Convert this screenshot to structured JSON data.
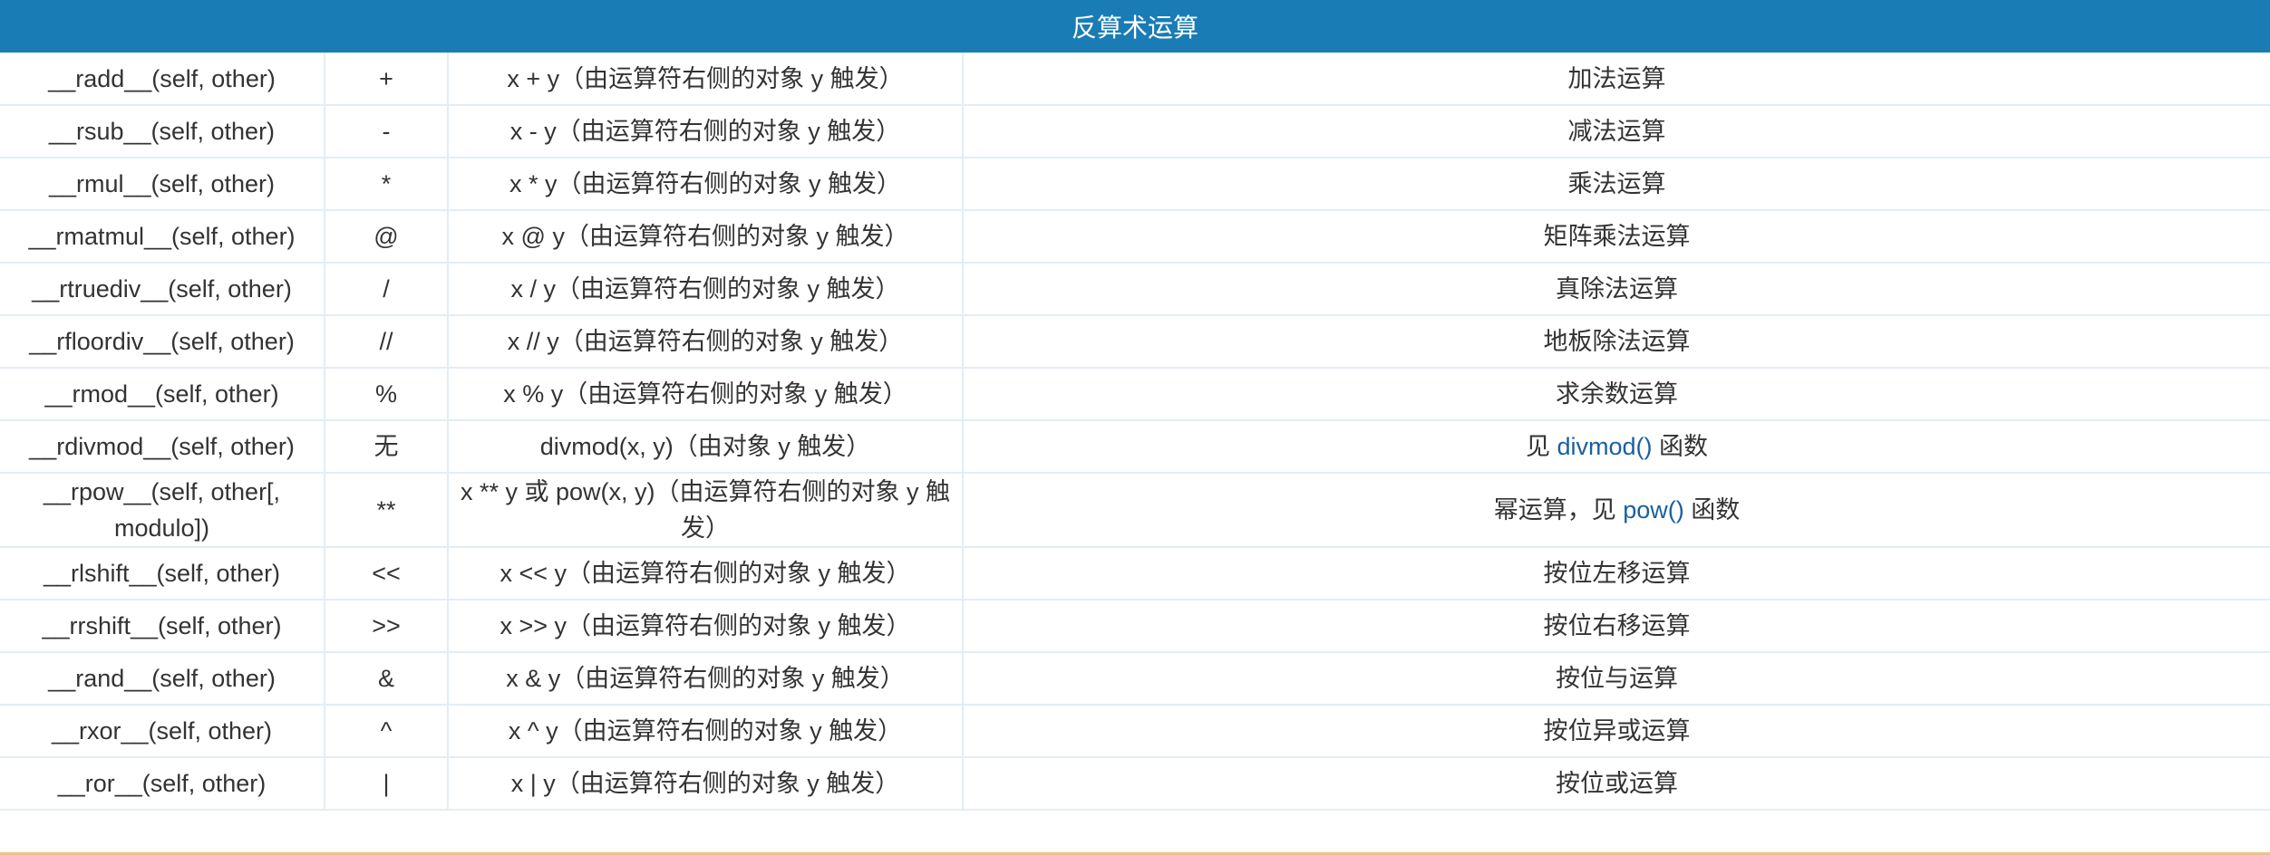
{
  "title": "反算术运算",
  "rows": [
    {
      "method": "__radd__(self, other)",
      "op": "+",
      "expr": "x + y（由运算符右侧的对象 y 触发）",
      "desc": "加法运算"
    },
    {
      "method": "__rsub__(self, other)",
      "op": "-",
      "expr": "x - y（由运算符右侧的对象 y 触发）",
      "desc": "减法运算"
    },
    {
      "method": "__rmul__(self, other)",
      "op": "*",
      "expr": "x * y（由运算符右侧的对象 y 触发）",
      "desc": "乘法运算"
    },
    {
      "method": "__rmatmul__(self, other)",
      "op": "@",
      "expr": "x @ y（由运算符右侧的对象 y 触发）",
      "desc": "矩阵乘法运算"
    },
    {
      "method": "__rtruediv__(self, other)",
      "op": "/",
      "expr": "x / y（由运算符右侧的对象 y 触发）",
      "desc": "真除法运算"
    },
    {
      "method": "__rfloordiv__(self, other)",
      "op": "//",
      "expr": "x // y（由运算符右侧的对象 y 触发）",
      "desc": "地板除法运算"
    },
    {
      "method": "__rmod__(self, other)",
      "op": "%",
      "expr": "x % y（由运算符右侧的对象 y 触发）",
      "desc": "求余数运算"
    },
    {
      "method": "__rdivmod__(self, other)",
      "op": "无",
      "expr": "divmod(x, y)（由对象 y 触发）",
      "desc_pre": "见 ",
      "desc_link": "divmod()",
      "desc_post": " 函数"
    },
    {
      "method": "__rpow__(self, other[, modulo])",
      "op": "**",
      "expr": "x ** y 或 pow(x, y)（由运算符右侧的对象 y 触发）",
      "desc_pre": "幂运算，见 ",
      "desc_link": "pow()",
      "desc_post": " 函数"
    },
    {
      "method": "__rlshift__(self, other)",
      "op": "<<",
      "expr": "x << y（由运算符右侧的对象 y 触发）",
      "desc": "按位左移运算"
    },
    {
      "method": "__rrshift__(self, other)",
      "op": ">>",
      "expr": "x >> y（由运算符右侧的对象 y 触发）",
      "desc": "按位右移运算"
    },
    {
      "method": "__rand__(self, other)",
      "op": "&",
      "expr": "x & y（由运算符右侧的对象 y 触发）",
      "desc": "按位与运算"
    },
    {
      "method": "__rxor__(self, other)",
      "op": "^",
      "expr": "x ^ y（由运算符右侧的对象 y 触发）",
      "desc": "按位异或运算"
    },
    {
      "method": "__ror__(self, other)",
      "op": "|",
      "expr": "x | y（由运算符右侧的对象 y 触发）",
      "desc": "按位或运算"
    }
  ]
}
